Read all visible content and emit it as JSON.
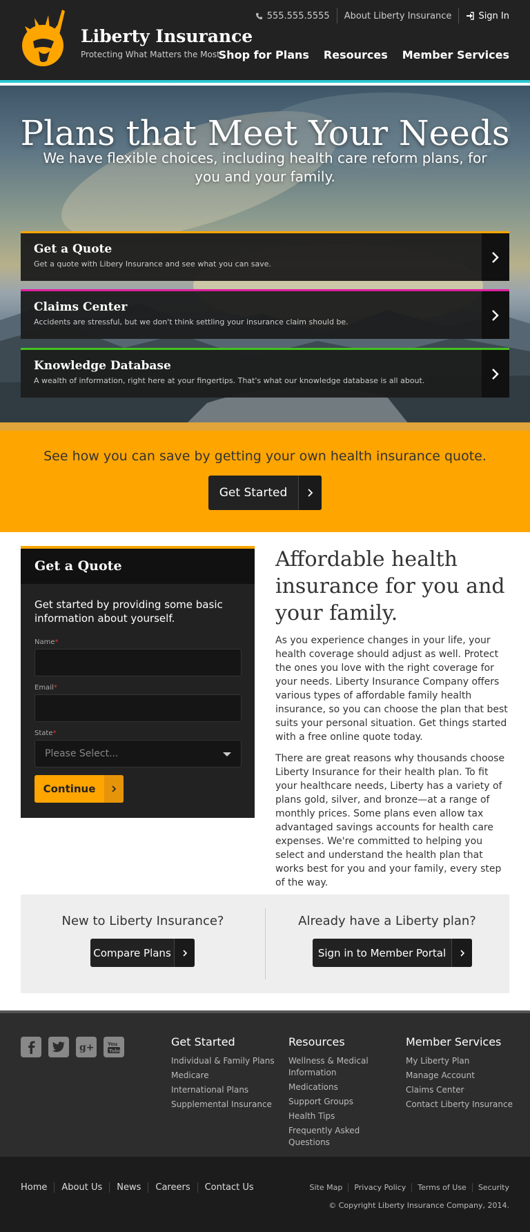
{
  "header": {
    "brand": "Liberty Insurance",
    "tagline": "Protecting What Matters the Most",
    "phone": "555.555.5555",
    "about_link": "About Liberty Insurance",
    "sign_in": "Sign In",
    "nav": [
      "Shop for Plans",
      "Resources",
      "Member Services"
    ]
  },
  "hero": {
    "title": "Plans that Meet Your Needs",
    "subtitle": "We have flexible choices, including health care reform plans, for you and your family.",
    "cards": [
      {
        "title": "Get a Quote",
        "desc": "Get a quote with Libery Insurance and see what you can save.",
        "accent": "#ffa500"
      },
      {
        "title": "Claims Center",
        "desc": "Accidents are stressful, but we don't think settling your insurance claim should be.",
        "accent": "#e020a0"
      },
      {
        "title": "Knowledge Database",
        "desc": "A wealth of information, right here at your fingertips. That's what our knowledge database is all about.",
        "accent": "#44c21f"
      }
    ]
  },
  "cta": {
    "text": "See how you can save by getting your own health insurance quote.",
    "button": "Get Started"
  },
  "quote_form": {
    "title": "Get a Quote",
    "intro": "Get started by providing some basic information about yourself.",
    "name_label": "Name",
    "email_label": "Email",
    "state_label": "State",
    "required_mark": "*",
    "state_placeholder": "Please Select...",
    "submit": "Continue"
  },
  "article": {
    "title": "Affordable health insurance for you and your family.",
    "p1": "As you experience changes in your life, your health coverage should adjust as well. Protect the ones you love with the right coverage for your needs. Liberty Insurance Company offers various types of affordable family health insurance, so you can choose the plan that best suits your personal situation. Get things started with a free online quote today.",
    "p2": "There are great reasons why thousands choose Liberty Insurance for their health plan. To fit your healthcare needs, Liberty has a variety of plans gold, silver, and bronze—at a range of monthly prices. Some plans even allow tax advantaged savings accounts for health care expenses. We're committed to helping you select and understand the health plan that works best for you and your family, every step of the way."
  },
  "split": {
    "left_q": "New to Liberty Insurance?",
    "left_btn": "Compare Plans",
    "right_q": "Already have a Liberty plan?",
    "right_btn": "Sign in to Member Portal"
  },
  "footer": {
    "social_icons": [
      "facebook-icon",
      "twitter-icon",
      "google-plus-icon",
      "youtube-icon"
    ],
    "columns": [
      {
        "heading": "Get Started",
        "links": [
          "Individual & Family Plans",
          "Medicare",
          "International Plans",
          "Supplemental Insurance"
        ]
      },
      {
        "heading": "Resources",
        "links": [
          "Wellness & Medical Information",
          "Medications",
          "Support Groups",
          "Health Tips",
          "Frequently Asked Questions"
        ]
      },
      {
        "heading": "Member Services",
        "links": [
          "My Liberty Plan",
          "Manage Account",
          "Claims Center",
          "Contact Liberty Insurance"
        ]
      }
    ],
    "nav": [
      "Home",
      "About Us",
      "News",
      "Careers",
      "Contact Us"
    ],
    "legal": [
      "Site Map",
      "Privacy Policy",
      "Terms of Use",
      "Security"
    ],
    "copyright": "© Copyright Liberty Insurance Company, 2014."
  },
  "colors": {
    "accent": "#ffa500",
    "teal": "#2ec9d4",
    "dark": "#222222"
  }
}
